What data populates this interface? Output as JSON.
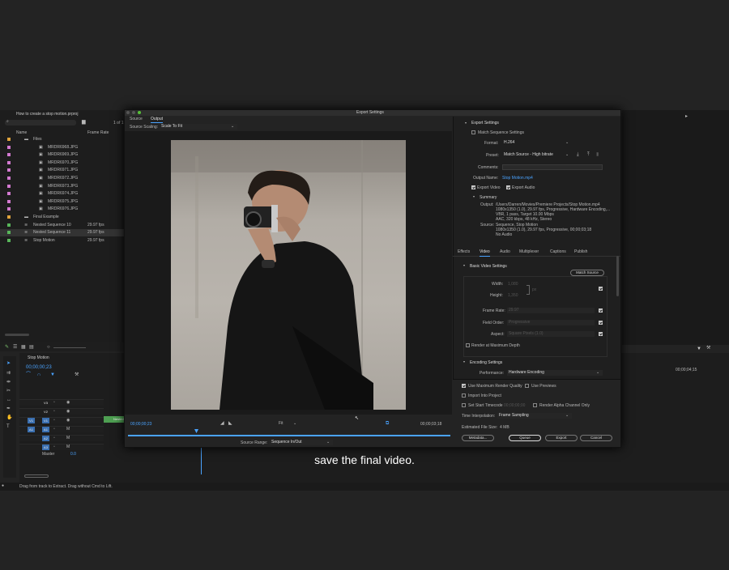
{
  "project": {
    "title": "How to create a stop motion.prproj",
    "page": "1 of 1",
    "col_name": "Name",
    "col_rate": "Frame Rate",
    "items": [
      {
        "name": "Files",
        "rate": "",
        "kind": "folder",
        "color": "#e0a43c"
      },
      {
        "name": "MRDR6968.JPG",
        "rate": "",
        "kind": "img",
        "color": "#d37ad1"
      },
      {
        "name": "MRDR6969.JPG",
        "rate": "",
        "kind": "img",
        "color": "#d37ad1"
      },
      {
        "name": "MRDR6970.JPG",
        "rate": "",
        "kind": "img",
        "color": "#d37ad1"
      },
      {
        "name": "MRDR6971.JPG",
        "rate": "",
        "kind": "img",
        "color": "#d37ad1"
      },
      {
        "name": "MRDR6972.JPG",
        "rate": "",
        "kind": "img",
        "color": "#d37ad1"
      },
      {
        "name": "MRDR6973.JPG",
        "rate": "",
        "kind": "img",
        "color": "#d37ad1"
      },
      {
        "name": "MRDR6974.JPG",
        "rate": "",
        "kind": "img",
        "color": "#d37ad1"
      },
      {
        "name": "MRDR6975.JPG",
        "rate": "",
        "kind": "img",
        "color": "#d37ad1"
      },
      {
        "name": "MRDR6976.JPG",
        "rate": "",
        "kind": "img",
        "color": "#d37ad1"
      },
      {
        "name": "Final Example",
        "rate": "",
        "kind": "folder",
        "color": "#e0a43c"
      },
      {
        "name": "Nested Sequence 10",
        "rate": "29.97 fps",
        "kind": "seq",
        "color": "#58b65a"
      },
      {
        "name": "Nested Sequence 11",
        "rate": "29.97 fps",
        "kind": "seq",
        "color": "#58b65a"
      },
      {
        "name": "Stop Motion",
        "rate": "29.97 fps",
        "kind": "seq",
        "color": "#58b65a"
      }
    ]
  },
  "timeline": {
    "name": "Stop Motion",
    "timecode": "00;00;00;23",
    "ruler_end": "00;00;04;15",
    "tracks": [
      {
        "lock": "",
        "label": "V3"
      },
      {
        "lock": "",
        "label": "V2"
      },
      {
        "lock": "V1",
        "label": "V1"
      },
      {
        "lock": "A1",
        "label": "A1"
      },
      {
        "lock": "",
        "label": "A2"
      },
      {
        "lock": "",
        "label": "A3"
      }
    ],
    "master": "Master",
    "master_val": "0.0",
    "clip": "Nested"
  },
  "dialog": {
    "title": "Export Settings",
    "tabs": [
      "Source",
      "Output"
    ],
    "source_scaling_label": "Source Scaling:",
    "source_scaling": "Scale To Fit",
    "tc_in": "00;00;00;23",
    "tc_out": "00;00;03;18",
    "fit": "Fit",
    "source_range_label": "Source Range:",
    "source_range": "Sequence In/Out",
    "export_settings": "Export Settings",
    "match_seq": "Match Sequence Settings",
    "format_label": "Format:",
    "format": "H.264",
    "preset_label": "Preset:",
    "preset": "Match Source - High bitrate",
    "comments_label": "Comments:",
    "output_name_label": "Output Name:",
    "output_name": "Stop Motion.mp4",
    "export_video": "Export Video",
    "export_audio": "Export Audio",
    "summary": "Summary",
    "output_label": "Output:",
    "output_lines": [
      "/Users/Darren/Movies/Premiere Projects/Stop Motion.mp4",
      "1080x1350 (1.0), 29.97 fps, Progressive, Hardware Encoding,...",
      "VBR, 1 pass, Target 10.00 Mbps",
      "AAC, 320 kbps, 48 kHz, Stereo"
    ],
    "source_label": "Source:",
    "source_lines": [
      "Sequence, Stop Motion",
      "1080x1350 (1.0), 29.97 fps, Progressive, 00;00;03;18",
      "No Audio"
    ],
    "settings_tabs": [
      "Effects",
      "Video",
      "Audio",
      "Multiplexer",
      "Captions",
      "Publish"
    ],
    "basic_video": "Basic Video Settings",
    "match_source": "Match Source",
    "width_label": "Width:",
    "width": "1,080",
    "height_label": "Height:",
    "height": "1,350",
    "px": "px",
    "frame_rate_label": "Frame Rate:",
    "frame_rate": "29.97",
    "field_order_label": "Field Order:",
    "field_order": "Progressive",
    "aspect_label": "Aspect:",
    "aspect": "Square Pixels (1.0)",
    "render_max_depth": "Render at Maximum Depth",
    "encoding": "Encoding Settings",
    "performance_label": "Performance:",
    "performance": "Hardware Encoding",
    "use_max_render": "Use Maximum Render Quality",
    "use_previews": "Use Previews",
    "import_project": "Import Into Project",
    "set_start_tc": "Set Start Timecode",
    "start_tc": "00;00;00;00",
    "render_alpha": "Render Alpha Channel Only",
    "time_interp_label": "Time Interpolation:",
    "time_interp": "Frame Sampling",
    "est_size_label": "Estimated File Size:",
    "est_size": "4 MB",
    "metadata": "Metadata...",
    "queue": "Queue",
    "export": "Export",
    "cancel": "Cancel"
  },
  "status": "Drag from track to Extract. Drag without Cmd to Lift.",
  "caption": "save the final video."
}
